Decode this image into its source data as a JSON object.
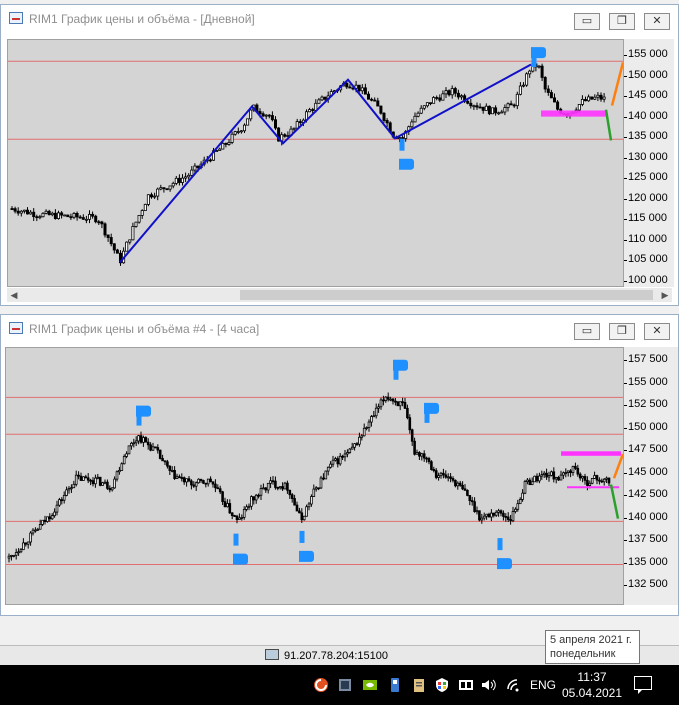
{
  "window1": {
    "title": "RIM1 График цены и объёма - [Дневной]",
    "y_ticks": [
      "155 000",
      "150 000",
      "145 000",
      "140 000",
      "135 000",
      "130 000",
      "125 000",
      "120 000",
      "115 000",
      "110 000",
      "105 000",
      "100 000"
    ]
  },
  "window2": {
    "title": "RIM1 График цены и объёма #4 - [4 часа]",
    "y_ticks": [
      "157 500",
      "155 000",
      "152 500",
      "150 000",
      "147 500",
      "145 000",
      "142 500",
      "140 000",
      "137 500",
      "135 000",
      "132 500"
    ]
  },
  "window_buttons": {
    "minimize": "▭",
    "restore": "❐",
    "close": "✕"
  },
  "status": {
    "connection": "91.207.78.204:15100"
  },
  "tooltip": {
    "line1": "5 апреля 2021 г.",
    "line2": "понедельник"
  },
  "taskbar": {
    "language": "ENG",
    "time": "11:37",
    "date": "05.04.2021"
  },
  "colors": {
    "chart_bg": "#d4d4d4",
    "level_line": "#e07070",
    "trend_line": "#1010c8",
    "arrow": "#1e90ff",
    "zone": "#ff33ff",
    "projection_down": "#2ca02c",
    "projection_up": "#ff7f0e"
  },
  "chart_data": [
    {
      "type": "candlestick",
      "title": "RIM1 График цены и объёма - [Дневной]",
      "ylim": [
        100000,
        157500
      ],
      "y_ticks": [
        155000,
        150000,
        145000,
        140000,
        135000,
        130000,
        125000,
        120000,
        115000,
        110000,
        105000,
        100000
      ],
      "horizontal_levels": [
        153800,
        134800
      ],
      "pivots": [
        {
          "name": "low",
          "y": 104800
        },
        {
          "name": "high",
          "y": 142800
        },
        {
          "name": "low",
          "y": 133800
        },
        {
          "name": "high",
          "y": 149300
        },
        {
          "name": "low",
          "y": 135000
        },
        {
          "name": "high",
          "y": 153000
        }
      ],
      "zone": [
        140300,
        141800
      ],
      "grid": false
    },
    {
      "type": "candlestick",
      "title": "RIM1 График цены и объёма #4 - [4 часа]",
      "ylim": [
        130500,
        158500
      ],
      "y_ticks": [
        157500,
        155000,
        152500,
        150000,
        147500,
        145000,
        142500,
        140000,
        137500,
        135000,
        132500
      ],
      "horizontal_levels": [
        153500,
        149400,
        139700,
        134900
      ],
      "zone": [
        147000,
        147500
      ],
      "support_line": 143500,
      "grid": false
    }
  ]
}
